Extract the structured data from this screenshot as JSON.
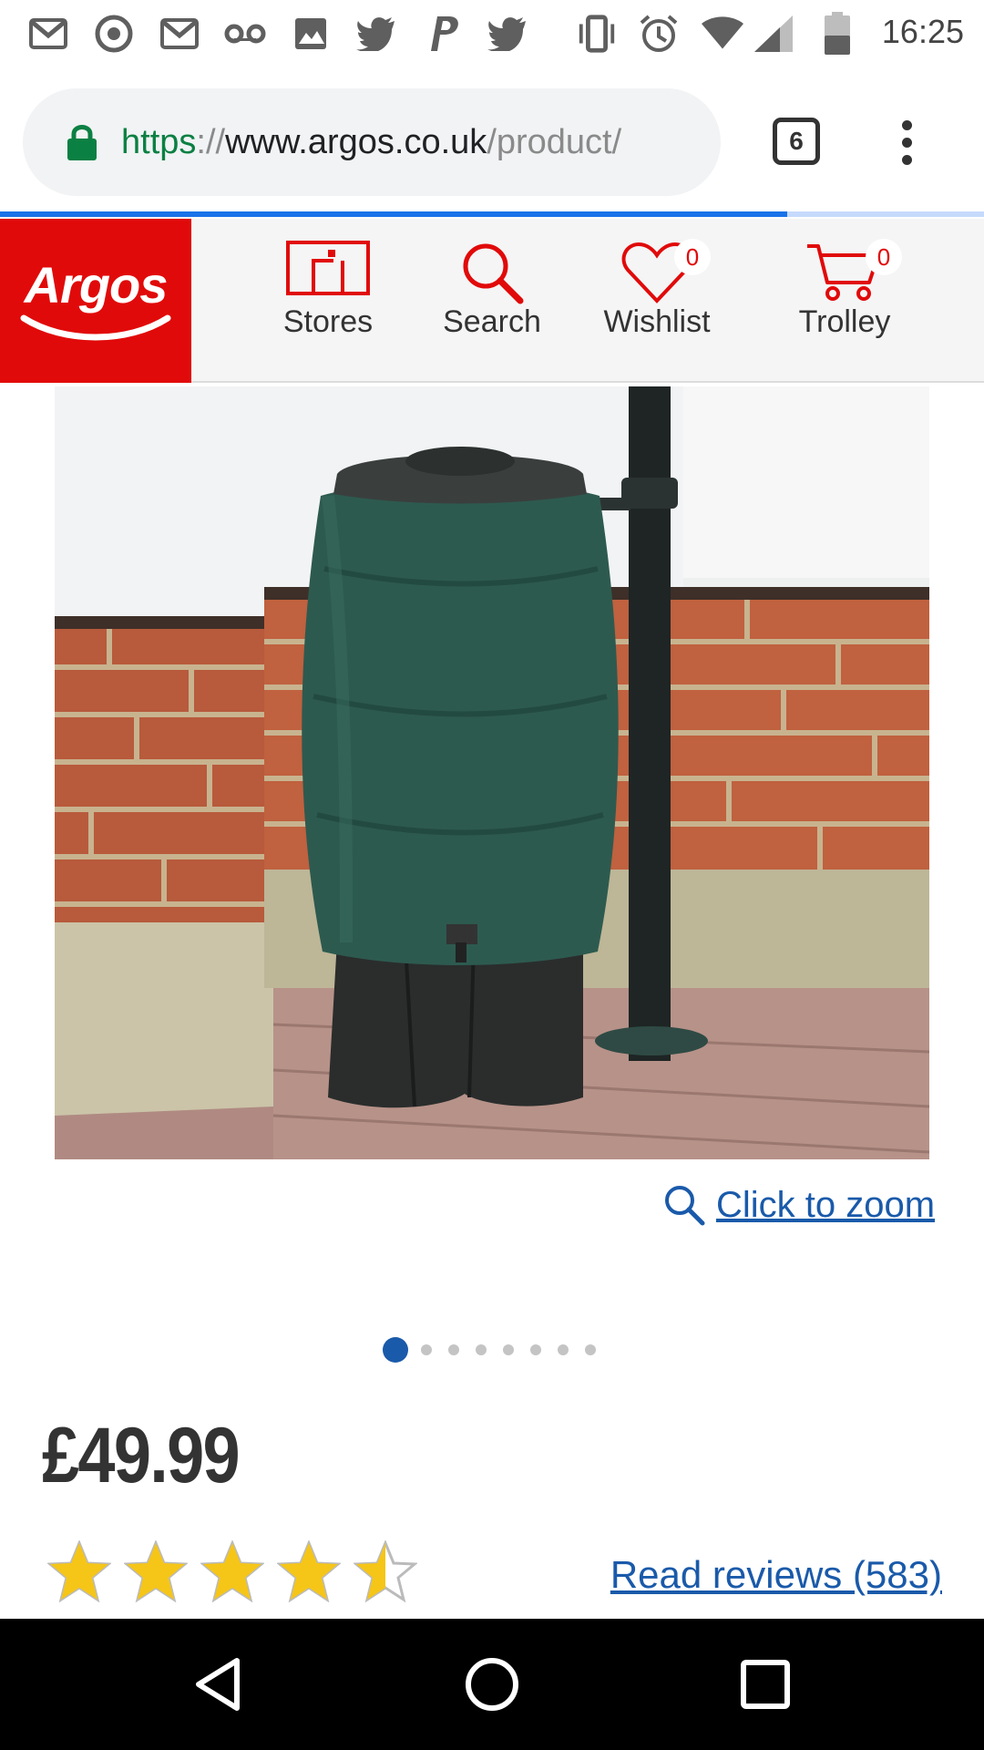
{
  "status_bar": {
    "time": "16:25",
    "battery_level": "45",
    "icons": [
      "gmail-icon",
      "chrome-icon",
      "gmail-icon",
      "voicemail-icon",
      "image-icon",
      "twitter-icon",
      "paypal-icon",
      "twitter-icon",
      "vibrate-icon",
      "alarm-icon",
      "wifi-icon",
      "signal-icon",
      "battery-icon"
    ]
  },
  "browser": {
    "url_scheme": "https",
    "url_sep": "://",
    "url_host": "www.argos.co.uk",
    "url_path": "/product/",
    "tab_count": "6",
    "load_progress": 0.8
  },
  "header": {
    "logo_text": "Argos",
    "nav": [
      {
        "label": "Stores"
      },
      {
        "label": "Search"
      },
      {
        "label": "Wishlist",
        "count": "0"
      },
      {
        "label": "Trolley",
        "count": "0"
      }
    ]
  },
  "product": {
    "zoom_label": "Click to zoom",
    "image_count": 8,
    "active_image": 1,
    "price": "£49.99",
    "rating": 4.5,
    "rating_max": 5,
    "reviews_label": "Read reviews (583)"
  },
  "colors": {
    "brand_red": "#e10a0a",
    "link_blue": "#1a5aaa",
    "star_gold": "#f5c518"
  }
}
